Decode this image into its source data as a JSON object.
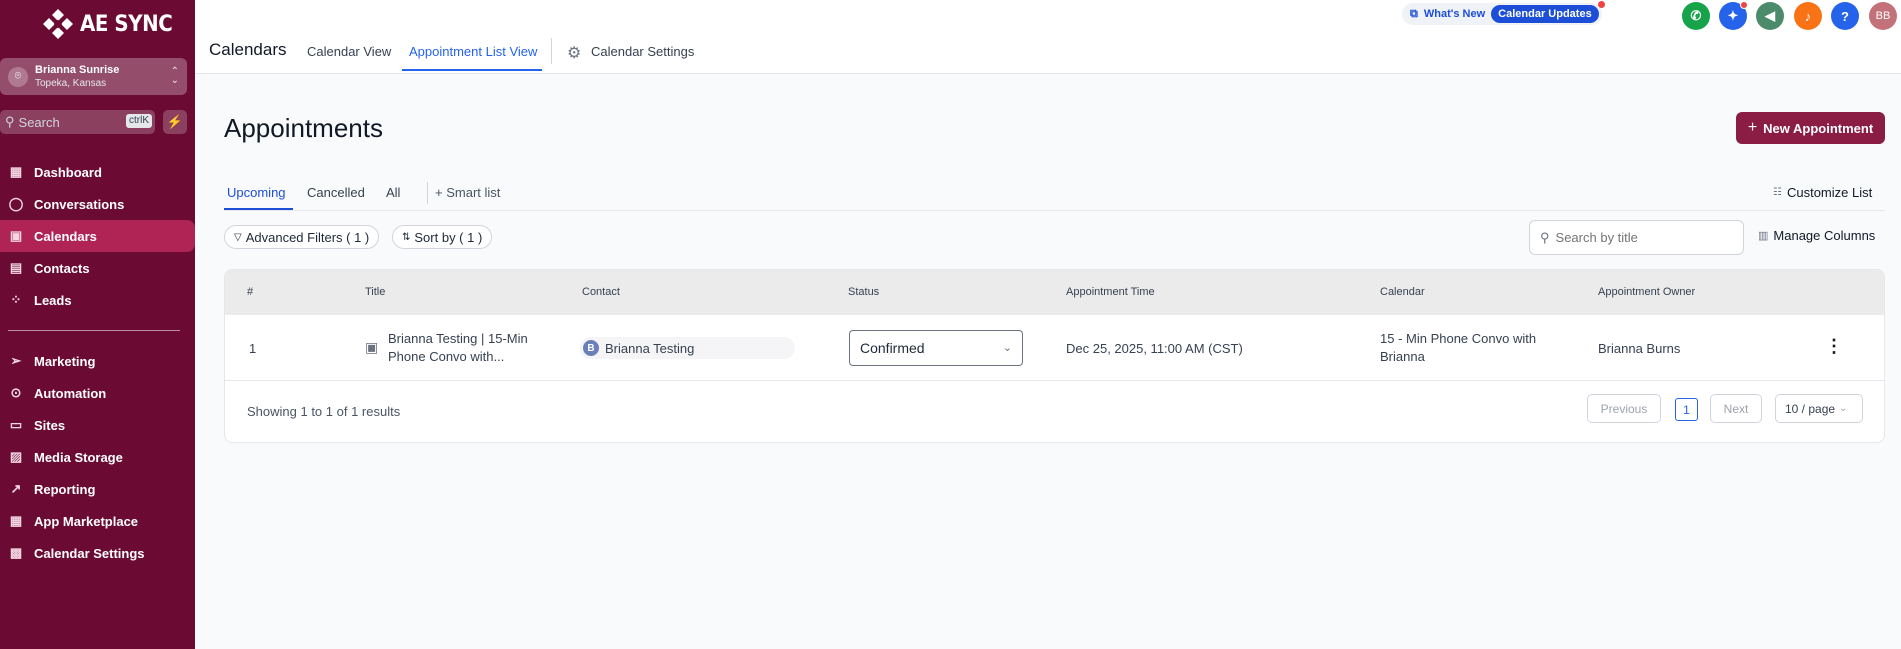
{
  "sidebar": {
    "logo_text": "AE SYNC",
    "account": {
      "name": "Brianna Sunrise",
      "location": "Topeka, Kansas"
    },
    "search": {
      "placeholder": "Search",
      "shortcut": "ctrlK"
    },
    "nav_primary": [
      {
        "label": "Dashboard",
        "icon": "grid-icon"
      },
      {
        "label": "Conversations",
        "icon": "chat-icon"
      },
      {
        "label": "Calendars",
        "icon": "calendar-icon",
        "active": true
      },
      {
        "label": "Contacts",
        "icon": "contacts-icon"
      },
      {
        "label": "Leads",
        "icon": "leads-icon"
      }
    ],
    "nav_secondary": [
      {
        "label": "Marketing",
        "icon": "send-icon"
      },
      {
        "label": "Automation",
        "icon": "automation-icon"
      },
      {
        "label": "Sites",
        "icon": "sites-icon"
      },
      {
        "label": "Media Storage",
        "icon": "image-icon"
      },
      {
        "label": "Reporting",
        "icon": "trend-icon"
      },
      {
        "label": "App Marketplace",
        "icon": "apps-icon"
      },
      {
        "label": "Calendar Settings",
        "icon": "calendar-settings-icon"
      }
    ]
  },
  "topbar": {
    "page_name": "Calendars",
    "tabs": [
      "Calendar View",
      "Appointment List View"
    ],
    "settings_tab": "Calendar Settings",
    "whats_new": "What's New",
    "updates_pill": "Calendar Updates",
    "avatar_initials": "BB",
    "help_label": "?",
    "colors": {
      "phone": "#16a34a",
      "magic": "#2563eb",
      "megaphone": "#4b8a6b",
      "bell": "#f97316",
      "help": "#2563eb",
      "avatar": "#c4727a"
    }
  },
  "main": {
    "title": "Appointments",
    "new_button": "New Appointment",
    "subtabs": [
      "Upcoming",
      "Cancelled",
      "All"
    ],
    "smart_list": "Smart list",
    "customize": "Customize List",
    "filters_chip": "Advanced Filters ( 1 )",
    "sort_chip": "Sort by ( 1 )",
    "search_placeholder": "Search by title",
    "manage_columns": "Manage Columns",
    "table": {
      "headers": [
        "#",
        "Title",
        "Contact",
        "Status",
        "Appointment Time",
        "Calendar",
        "Appointment Owner"
      ],
      "rows": [
        {
          "num": "1",
          "title_line1": "Brianna Testing | 15-Min",
          "title_line2": "Phone Convo with...",
          "contact_initial": "B",
          "contact": "Brianna Testing",
          "status": "Confirmed",
          "time": "Dec 25, 2025, 11:00 AM (CST)",
          "calendar_line1": "15 - Min Phone Convo with",
          "calendar_line2": "Brianna",
          "owner": "Brianna Burns"
        }
      ]
    },
    "pagination": {
      "summary": "Showing 1 to 1 of 1 results",
      "previous": "Previous",
      "current": "1",
      "next": "Next",
      "per_page": "10 / page"
    },
    "accent": "#8b1d45"
  }
}
